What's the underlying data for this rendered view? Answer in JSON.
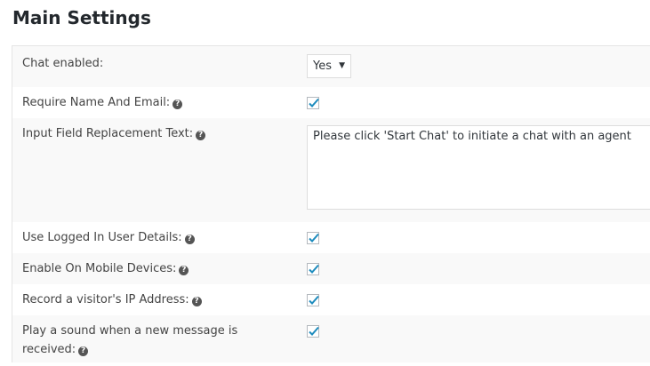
{
  "title": "Main Settings",
  "rows": [
    {
      "label": "Chat enabled:",
      "control": "select",
      "value": "Yes"
    },
    {
      "label": "Require Name And Email:",
      "control": "checkbox",
      "checked": true
    },
    {
      "label": "Input Field Replacement Text:",
      "control": "textarea",
      "value": "Please click 'Start Chat' to initiate a chat with an agent"
    },
    {
      "label": "Use Logged In User Details:",
      "control": "checkbox",
      "checked": true
    },
    {
      "label": "Enable On Mobile Devices:",
      "control": "checkbox",
      "checked": true
    },
    {
      "label": "Record a visitor's IP Address:",
      "control": "checkbox",
      "checked": true
    },
    {
      "label": "Play a sound when a new message is received:",
      "control": "checkbox",
      "checked": true
    }
  ],
  "help_glyph": "?",
  "select_arrow": "▼"
}
